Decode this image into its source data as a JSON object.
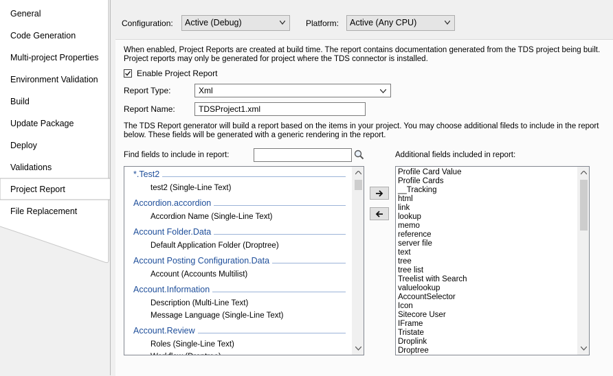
{
  "nav": {
    "items": [
      {
        "label": "General"
      },
      {
        "label": "Code Generation"
      },
      {
        "label": "Multi-project Properties"
      },
      {
        "label": "Environment Validation"
      },
      {
        "label": "Build"
      },
      {
        "label": "Update Package"
      },
      {
        "label": "Deploy"
      },
      {
        "label": "Validations"
      },
      {
        "label": "Project Report",
        "selected": true
      },
      {
        "label": "File Replacement"
      }
    ]
  },
  "header": {
    "configuration_label": "Configuration:",
    "configuration_value": "Active (Debug)",
    "platform_label": "Platform:",
    "platform_value": "Active (Any CPU)"
  },
  "report": {
    "description_line1": "When enabled, Project Reports are created at build time. The report contains documentation generated from the TDS project being built.",
    "description_line2": "Project reports may only be generated for project where the TDS connector is installed.",
    "enable_label": "Enable Project Report",
    "enable_checked": true,
    "type_label": "Report Type:",
    "type_value": "Xml",
    "name_label": "Report Name:",
    "name_value": "TDSProject1.xml",
    "generator_line1": "The TDS Report generator will build a report based on the items in your project. You may choose additional fileds to include in the report",
    "generator_line2": "below. These fields will be generated with a generic rendering in the report.",
    "find_label": "Find fields to include in report:",
    "find_value": "",
    "additional_label": "Additional fields included in report:"
  },
  "template_groups": [
    {
      "name": "*.Test2",
      "fields": [
        "test2 (Single-Line Text)"
      ]
    },
    {
      "name": "Accordion.accordion",
      "fields": [
        "Accordion Name (Single-Line Text)"
      ]
    },
    {
      "name": "Account Folder.Data",
      "fields": [
        "Default Application Folder (Droptree)"
      ]
    },
    {
      "name": "Account Posting Configuration.Data",
      "fields": [
        "Account (Accounts Multilist)"
      ]
    },
    {
      "name": "Account.Information",
      "fields": [
        "Description (Multi-Line Text)",
        "Message Language (Single-Line Text)"
      ]
    },
    {
      "name": "Account.Review",
      "fields": [
        "Roles (Single-Line Text)",
        "Workflow (Droptree)"
      ]
    }
  ],
  "additional_fields": [
    "Profile Card Value",
    "Profile Cards",
    "__Tracking",
    "html",
    "link",
    "lookup",
    "memo",
    "reference",
    "server file",
    "text",
    "tree",
    "tree list",
    "Treelist with Search",
    "valuelookup",
    "AccountSelector",
    "Icon",
    "Sitecore User",
    "IFrame",
    "Tristate",
    "Droplink",
    "Droptree"
  ],
  "icons": {
    "search": "search-icon",
    "add": "arrow-right-icon",
    "remove": "arrow-left-icon",
    "dropdown": "chevron-down-icon"
  },
  "colors": {
    "group_header": "#1e4e9a",
    "selected_tab_bg": "#ffffff",
    "panel_bg": "#f0f0f0"
  }
}
